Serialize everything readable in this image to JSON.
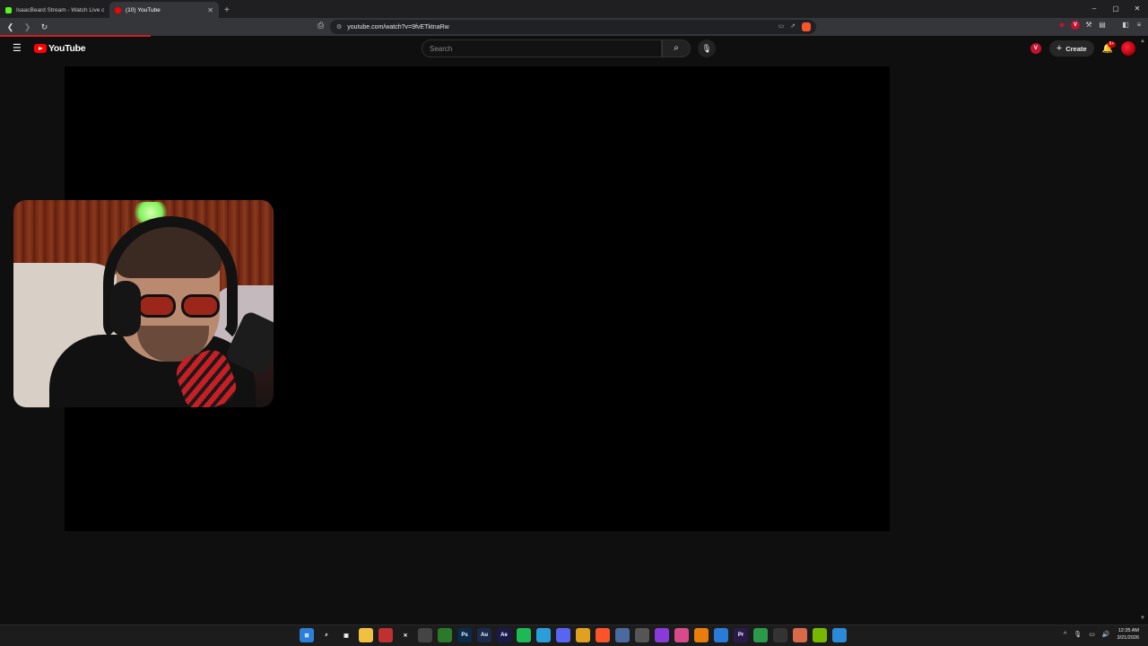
{
  "browser": {
    "tabs": [
      {
        "label": "IsaacBeard Stream - Watch Live on K",
        "favicon_color": "#53fc18",
        "active": false
      },
      {
        "label": "(10) YouTube",
        "favicon_color": "#ff0000",
        "active": true
      }
    ],
    "new_tab": "+",
    "window_controls": {
      "minimize": "–",
      "maximize": "▢",
      "close": "✕"
    },
    "url": "youtube.com/watch?v=9fvETktnaRw"
  },
  "youtube": {
    "logo_text": "YouTube",
    "search_placeholder": "Search",
    "create_label": "Create",
    "notification_badge": "9+",
    "profile_letter": "V"
  },
  "taskbar": {
    "apps": [
      {
        "icon": "windows-start-icon",
        "glyph": "⊞",
        "color": "#2b7fd8"
      },
      {
        "icon": "search-icon",
        "glyph": "⌕",
        "color": "transparent"
      },
      {
        "icon": "task-view-icon",
        "glyph": "▣",
        "color": "transparent"
      },
      {
        "icon": "file-explorer-icon",
        "glyph": "",
        "color": "#f0c040"
      },
      {
        "icon": "app-icon",
        "glyph": "",
        "color": "#c03030"
      },
      {
        "icon": "capcut-icon",
        "glyph": "✕",
        "color": "transparent"
      },
      {
        "icon": "app-icon",
        "glyph": "",
        "color": "#444"
      },
      {
        "icon": "xbox-icon",
        "glyph": "",
        "color": "#2a7a2a"
      },
      {
        "icon": "photoshop-icon",
        "glyph": "Ps",
        "color": "#0a2a4a"
      },
      {
        "icon": "audition-icon",
        "glyph": "Au",
        "color": "#1a2a4a"
      },
      {
        "icon": "after-effects-icon",
        "glyph": "Ae",
        "color": "#1a1a4a"
      },
      {
        "icon": "spotify-icon",
        "glyph": "",
        "color": "#1db954"
      },
      {
        "icon": "telegram-icon",
        "glyph": "",
        "color": "#2a9ed8"
      },
      {
        "icon": "discord-icon",
        "glyph": "",
        "color": "#5865f2"
      },
      {
        "icon": "chrome-icon",
        "glyph": "",
        "color": "#e0a020"
      },
      {
        "icon": "brave-icon",
        "glyph": "",
        "color": "#fb542b"
      },
      {
        "icon": "app-icon",
        "glyph": "",
        "color": "#4a6aa0"
      },
      {
        "icon": "app-icon",
        "glyph": "",
        "color": "#555"
      },
      {
        "icon": "app-icon",
        "glyph": "",
        "color": "#8a3ad8"
      },
      {
        "icon": "app-icon",
        "glyph": "",
        "color": "#d84a8a"
      },
      {
        "icon": "blender-icon",
        "glyph": "",
        "color": "#e87d0d"
      },
      {
        "icon": "app-icon",
        "glyph": "",
        "color": "#2a7ad8"
      },
      {
        "icon": "premiere-icon",
        "glyph": "Pr",
        "color": "#2a1a4a"
      },
      {
        "icon": "app-icon",
        "glyph": "",
        "color": "#2a9a4a"
      },
      {
        "icon": "app-icon",
        "glyph": "",
        "color": "#333"
      },
      {
        "icon": "app-icon",
        "glyph": "",
        "color": "#d86a4a"
      },
      {
        "icon": "nvidia-icon",
        "glyph": "",
        "color": "#76b900"
      },
      {
        "icon": "app-icon",
        "glyph": "",
        "color": "#2a8ad8"
      }
    ],
    "time": "12:35 AM",
    "date": "3/21/2026"
  },
  "colors": {
    "youtube_red": "#ff0000",
    "background": "#0f0f0f",
    "progress_red": "#cc1f24"
  }
}
